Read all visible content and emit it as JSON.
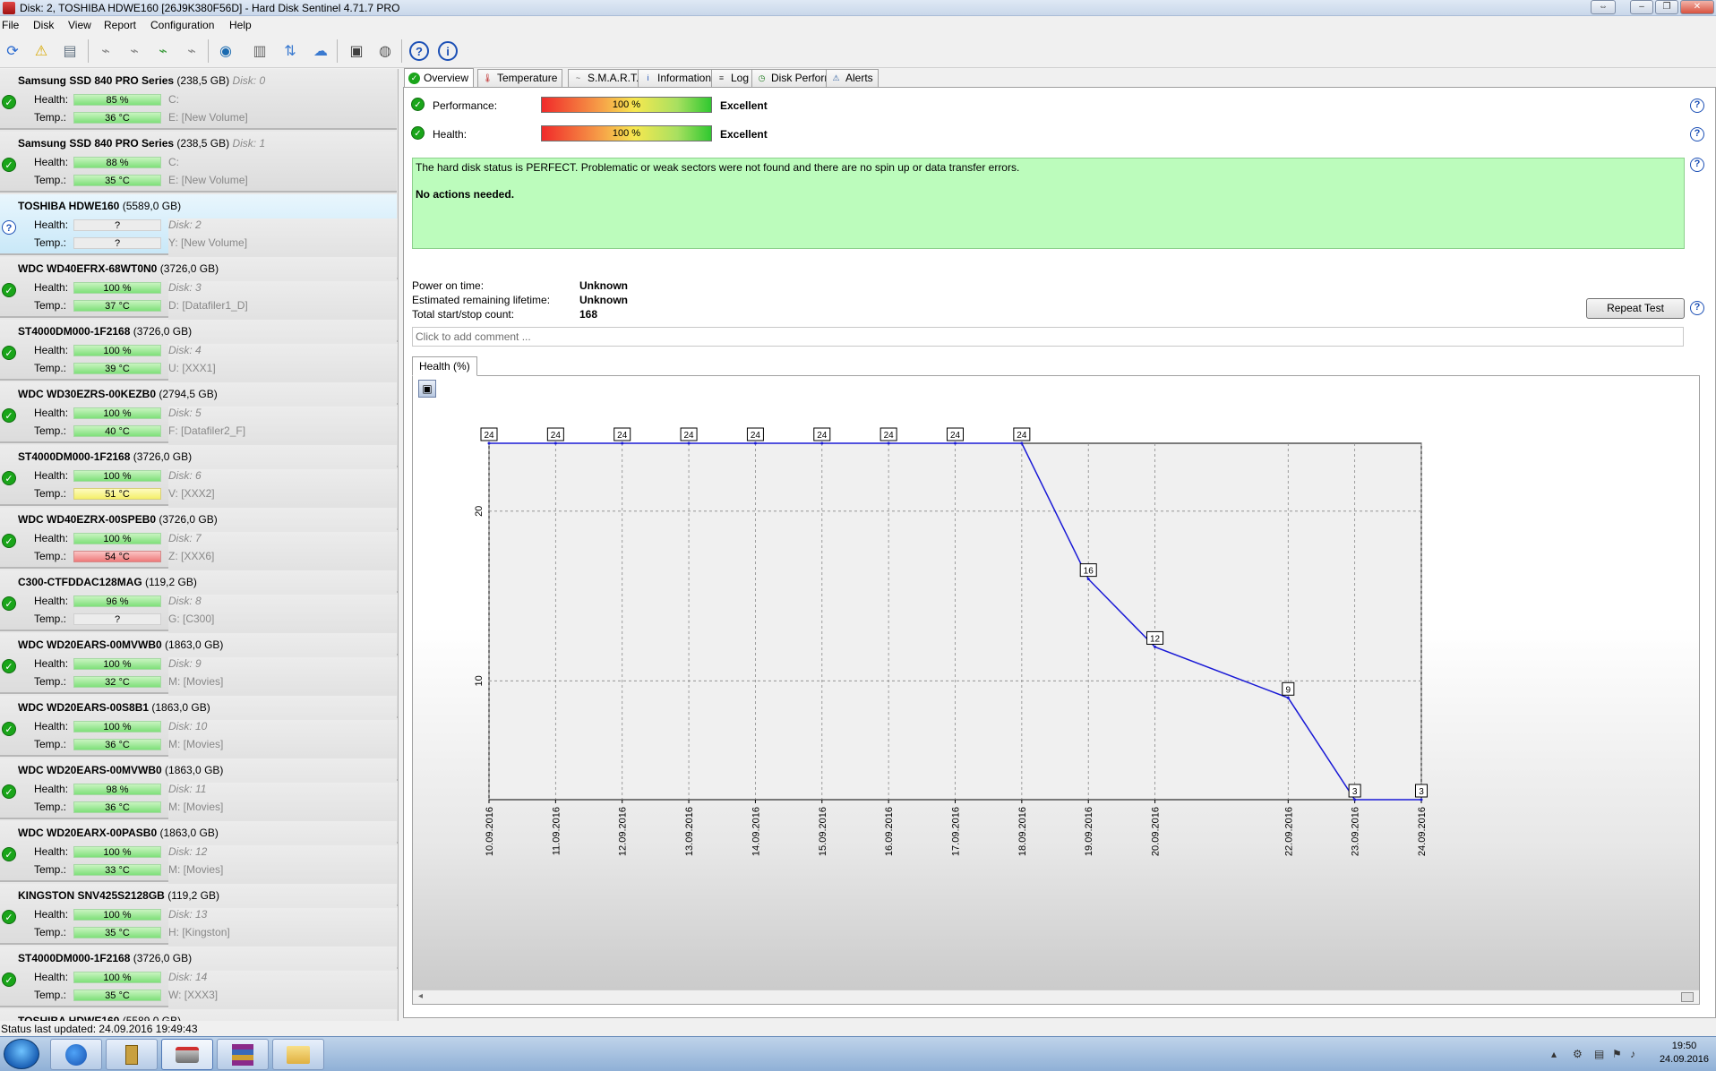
{
  "window": {
    "title": "Disk: 2, TOSHIBA HDWE160 [26J9K380F56D]  -  Hard Disk Sentinel 4.71.7 PRO"
  },
  "menu": [
    "File",
    "Disk",
    "View",
    "Report",
    "Configuration",
    "Help"
  ],
  "toolbar_icons": [
    "refresh-icon",
    "warning-icon",
    "disk-info-icon",
    "network-disk-icon",
    "network-disk-add-icon",
    "network-disk-check-icon",
    "network-disk-remove-icon",
    "globe-icon",
    "report-icon",
    "sync-icon",
    "network-share-icon",
    "monitor-icon",
    "speaker-icon",
    "help-icon",
    "info-icon"
  ],
  "disks": [
    {
      "name": "Samsung SSD 840 PRO Series",
      "size": "(238,5 GB)",
      "num": "Disk: 0",
      "health": "85 %",
      "temp": "36 °C",
      "temp_color": "green",
      "info1": "C:",
      "info2": "E: [New Volume]",
      "status": "ok"
    },
    {
      "name": "Samsung SSD 840 PRO Series",
      "size": "(238,5 GB)",
      "num": "Disk: 1",
      "health": "88 %",
      "temp": "35 °C",
      "temp_color": "green",
      "info1": "C:",
      "info2": "E: [New Volume]",
      "status": "ok"
    },
    {
      "name": "TOSHIBA HDWE160",
      "size": "(5589,0 GB)",
      "num": "",
      "health": "?",
      "temp": "?",
      "temp_color": "gray",
      "info1": "Disk: 2",
      "info2": "Y: [New Volume]",
      "status": "unknown",
      "selected": true
    },
    {
      "name": "WDC WD40EFRX-68WT0N0",
      "size": "(3726,0 GB)",
      "num": "",
      "health": "100 %",
      "temp": "37 °C",
      "temp_color": "green",
      "info1": "Disk: 3",
      "info2": "D: [Datafiler1_D]",
      "status": "ok"
    },
    {
      "name": "ST4000DM000-1F2168",
      "size": "(3726,0 GB)",
      "num": "",
      "health": "100 %",
      "temp": "39 °C",
      "temp_color": "green",
      "info1": "Disk: 4",
      "info2": "U: [XXX1]",
      "status": "ok"
    },
    {
      "name": "WDC WD30EZRS-00KEZB0",
      "size": "(2794,5 GB)",
      "num": "",
      "health": "100 %",
      "temp": "40 °C",
      "temp_color": "green",
      "info1": "Disk: 5",
      "info2": "F: [Datafiler2_F]",
      "status": "ok"
    },
    {
      "name": "ST4000DM000-1F2168",
      "size": "(3726,0 GB)",
      "num": "",
      "health": "100 %",
      "temp": "51 °C",
      "temp_color": "yellow",
      "info1": "Disk: 6",
      "info2": "V: [XXX2]",
      "status": "ok"
    },
    {
      "name": "WDC WD40EZRX-00SPEB0",
      "size": "(3726,0 GB)",
      "num": "",
      "health": "100 %",
      "temp": "54 °C",
      "temp_color": "red",
      "info1": "Disk: 7",
      "info2": "Z: [XXX6]",
      "status": "ok"
    },
    {
      "name": "C300-CTFDDAC128MAG",
      "size": "(119,2 GB)",
      "num": "",
      "health": "96 %",
      "temp": "?",
      "temp_color": "gray",
      "info1": "Disk: 8",
      "info2": "G: [C300]",
      "status": "ok"
    },
    {
      "name": "WDC WD20EARS-00MVWB0",
      "size": "(1863,0 GB)",
      "num": "",
      "health": "100 %",
      "temp": "32 °C",
      "temp_color": "green",
      "info1": "Disk: 9",
      "info2": "M: [Movies]",
      "status": "ok"
    },
    {
      "name": "WDC WD20EARS-00S8B1",
      "size": "(1863,0 GB)",
      "num": "",
      "health": "100 %",
      "temp": "36 °C",
      "temp_color": "green",
      "info1": "Disk: 10",
      "info2": "M: [Movies]",
      "status": "ok"
    },
    {
      "name": "WDC WD20EARS-00MVWB0",
      "size": "(1863,0 GB)",
      "num": "",
      "health": "98 %",
      "temp": "36 °C",
      "temp_color": "green",
      "info1": "Disk: 11",
      "info2": "M: [Movies]",
      "status": "ok"
    },
    {
      "name": "WDC WD20EARX-00PASB0",
      "size": "(1863,0 GB)",
      "num": "",
      "health": "100 %",
      "temp": "33 °C",
      "temp_color": "green",
      "info1": "Disk: 12",
      "info2": "M: [Movies]",
      "status": "ok"
    },
    {
      "name": "KINGSTON SNV425S2128GB",
      "size": "(119,2 GB)",
      "num": "",
      "health": "100 %",
      "temp": "35 °C",
      "temp_color": "green",
      "info1": "Disk: 13",
      "info2": "H: [Kingston]",
      "status": "ok"
    },
    {
      "name": "ST4000DM000-1F2168",
      "size": "(3726,0 GB)",
      "num": "",
      "health": "100 %",
      "temp": "35 °C",
      "temp_color": "green",
      "info1": "Disk: 14",
      "info2": "W: [XXX3]",
      "status": "ok"
    },
    {
      "name": "TOSHIBA HDWE160",
      "size": "(5589,0 GB)",
      "num": "",
      "health": "",
      "temp": "",
      "temp_color": "gray",
      "info1": "",
      "info2": "",
      "status": "ok"
    }
  ],
  "labels": {
    "health": "Health:",
    "temp": "Temp.:"
  },
  "tabs": [
    {
      "label": "Overview",
      "icon": "check-icon",
      "color": "#1aa51a"
    },
    {
      "label": "Temperature",
      "icon": "thermometer-icon",
      "color": "#c03030"
    },
    {
      "label": "S.M.A.R.T.",
      "icon": "smart-icon",
      "color": "#606060"
    },
    {
      "label": "Information",
      "icon": "info-icon",
      "color": "#1b4fb5"
    },
    {
      "label": "Log",
      "icon": "log-icon",
      "color": "#404040"
    },
    {
      "label": "Disk Performance",
      "icon": "performance-icon",
      "color": "#1f7a1f"
    },
    {
      "label": "Alerts",
      "icon": "alerts-icon",
      "color": "#3060a0"
    }
  ],
  "overview": {
    "performance_label": "Performance:",
    "performance_value": "100 %",
    "performance_rating": "Excellent",
    "health_label": "Health:",
    "health_value": "100 %",
    "health_rating": "Excellent",
    "message_line1": "The hard disk status is PERFECT. Problematic or weak sectors were not found and there are no spin up or data transfer errors.",
    "message_line2": "No actions needed.",
    "power_on_label": "Power on time:",
    "power_on_value": "Unknown",
    "lifetime_label": "Estimated remaining lifetime:",
    "lifetime_value": "Unknown",
    "startstop_label": "Total start/stop count:",
    "startstop_value": "168",
    "repeat_button": "Repeat Test",
    "comment_placeholder": "Click to add comment ...",
    "chart_tab": "Health (%)"
  },
  "chart_data": {
    "type": "line",
    "title": "",
    "xlabel": "",
    "ylabel": "",
    "x": [
      "10.09.2016",
      "11.09.2016",
      "12.09.2016",
      "13.09.2016",
      "14.09.2016",
      "15.09.2016",
      "16.09.2016",
      "17.09.2016",
      "18.09.2016",
      "19.09.2016",
      "20.09.2016",
      "22.09.2016",
      "23.09.2016",
      "24.09.2016"
    ],
    "x_days": [
      10,
      11,
      12,
      13,
      14,
      15,
      16,
      17,
      18,
      19,
      20,
      22,
      23,
      24
    ],
    "values": [
      24,
      24,
      24,
      24,
      24,
      24,
      24,
      24,
      24,
      16,
      12,
      9,
      3,
      3
    ],
    "ylim": [
      3,
      24
    ],
    "yticks": [
      "10",
      "20"
    ],
    "ytick_values": [
      10,
      20
    ],
    "grid": true,
    "line_color": "#1a1ad6"
  },
  "status": {
    "text": "Status last updated: 24.09.2016 19:49:43"
  },
  "taskbar": {
    "apps": [
      "firefox-icon",
      "hdsentinel-icon",
      "disk-app-icon",
      "winrar-icon",
      "explorer-icon"
    ],
    "time": "19:50",
    "date": "24.09.2016"
  }
}
